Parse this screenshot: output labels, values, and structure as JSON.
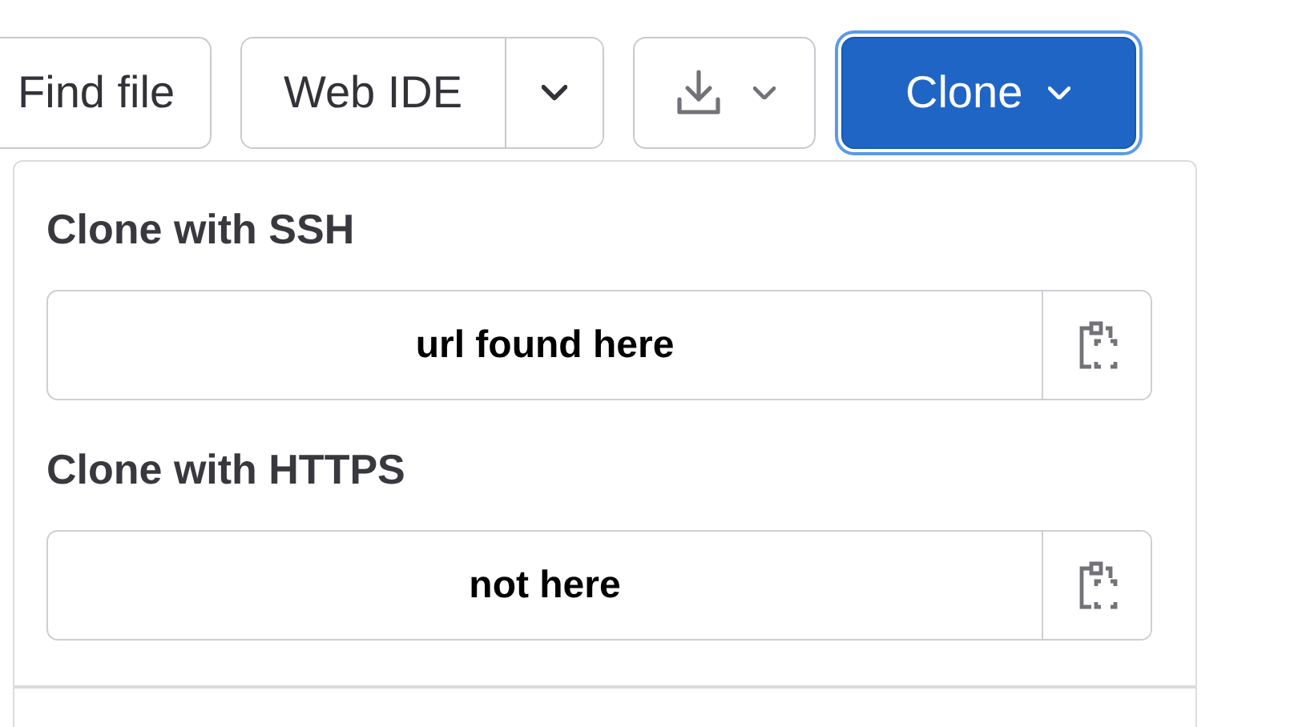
{
  "toolbar": {
    "find_file": "Find file",
    "web_ide": "Web IDE",
    "clone": {
      "label": "Clone",
      "expanded": true
    }
  },
  "clone_menu": {
    "sections": [
      {
        "title": "Clone with SSH",
        "value": "url found here"
      },
      {
        "title": "Clone with HTTPS",
        "value": "not here"
      }
    ]
  }
}
